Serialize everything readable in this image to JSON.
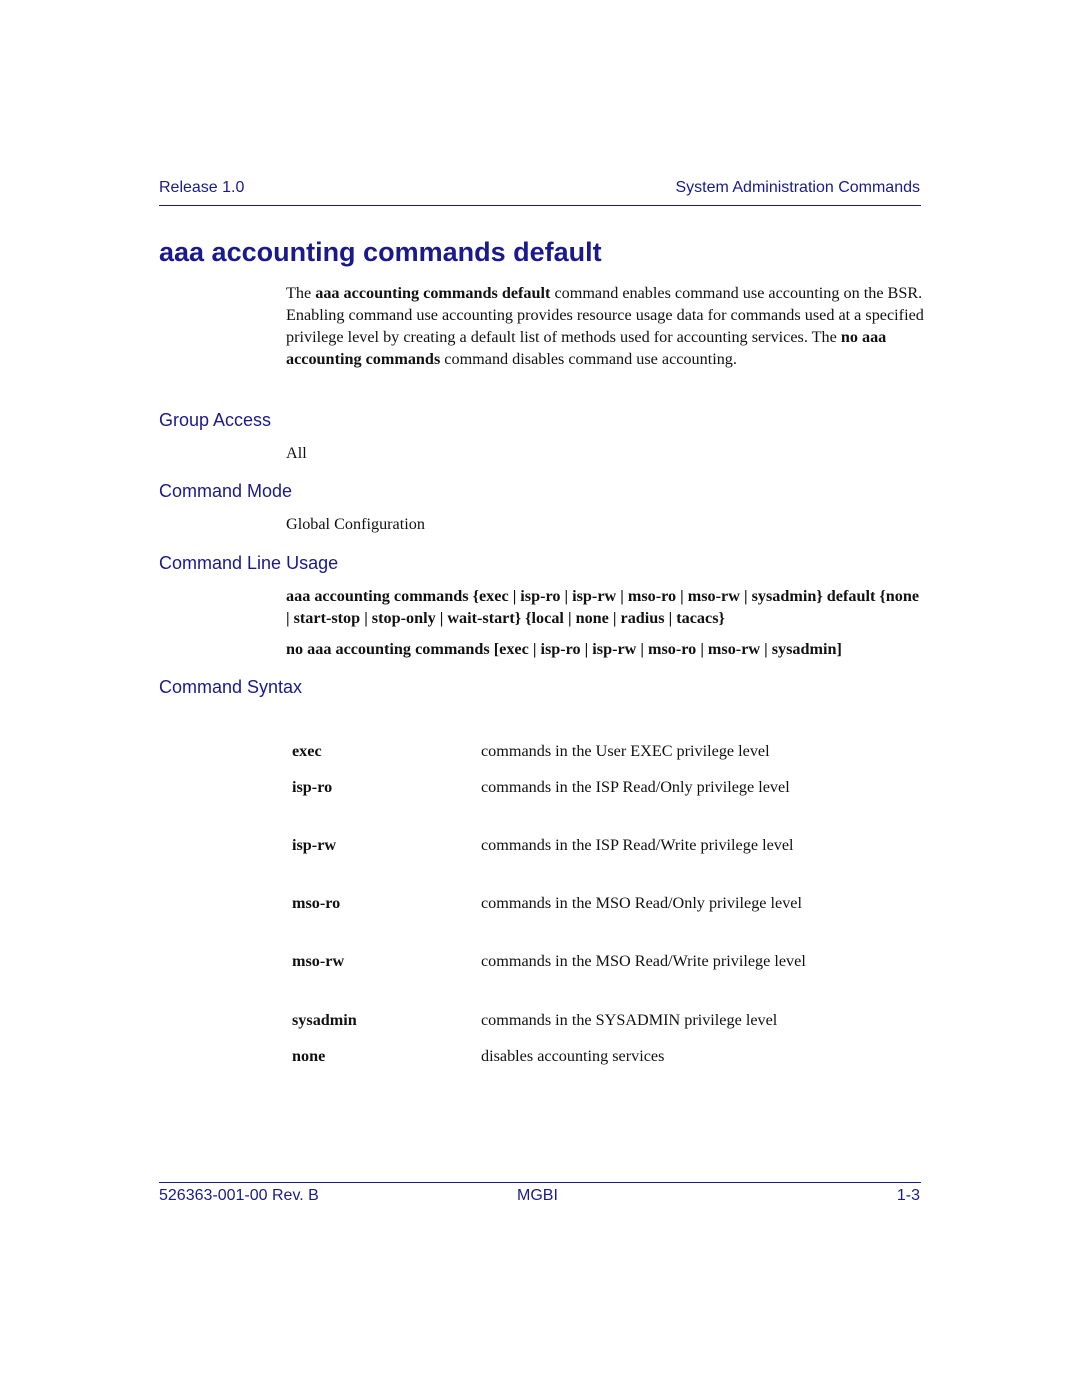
{
  "header": {
    "left": "Release 1.0",
    "right": "System Administration Commands"
  },
  "title": "aaa accounting commands default",
  "description": {
    "p1_pre": "The ",
    "p1_bold1": "aaa accounting commands default",
    "p1_mid": " command enables command use accounting on the BSR. Enabling command use accounting provides resource usage data for commands used at a specified privilege level by creating a default list of methods used for accounting services. The ",
    "p1_bold2": "no aaa accounting commands",
    "p1_post": " command disables command use accounting."
  },
  "sections": {
    "group_access": {
      "heading": "Group Access",
      "value": "All"
    },
    "command_mode": {
      "heading": "Command Mode",
      "value": "Global Configuration"
    },
    "command_line_usage": {
      "heading": "Command Line Usage",
      "line1": "aaa accounting commands {exec | isp-ro | isp-rw | mso-ro | mso-rw | sysadmin} default {none | start-stop | stop-only | wait-start} {local | none | radius | tacacs}",
      "line2": "no aaa accounting commands [exec | isp-ro | isp-rw | mso-ro | mso-rw | sysadmin]"
    },
    "command_syntax": {
      "heading": "Command Syntax",
      "rows": [
        {
          "term": "exec",
          "desc": "commands in the User EXEC privilege level"
        },
        {
          "term": "isp-ro",
          "desc": "commands in the ISP Read/Only privilege level"
        },
        {
          "term": "isp-rw",
          "desc": "commands in the ISP Read/Write privilege level"
        },
        {
          "term": "mso-ro",
          "desc": "commands in the MSO Read/Only privilege level"
        },
        {
          "term": "mso-rw",
          "desc": "commands in the MSO Read/Write privilege level"
        },
        {
          "term": "sysadmin",
          "desc": "commands in the SYSADMIN privilege level"
        },
        {
          "term": "none",
          "desc": "disables accounting services"
        }
      ]
    }
  },
  "footer": {
    "left": "526363-001-00 Rev. B",
    "middle": "MGBI",
    "right": "1-3"
  }
}
